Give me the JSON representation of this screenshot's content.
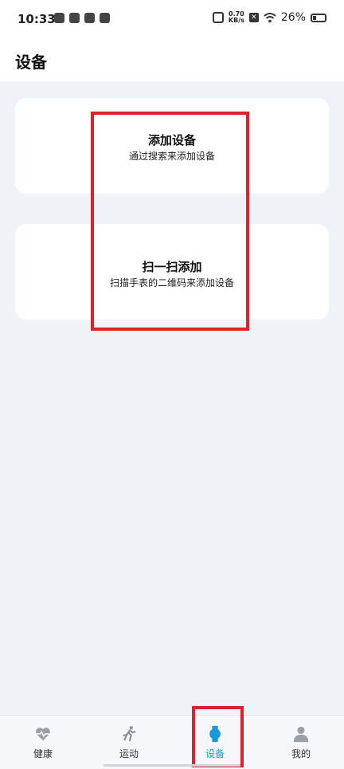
{
  "status_bar": {
    "time": "10:33",
    "net_speed_value": "0.70",
    "net_speed_unit": "KB/s",
    "battery": "26%"
  },
  "header": {
    "title": "设备"
  },
  "cards": [
    {
      "title": "添加设备",
      "subtitle": "通过搜索来添加设备"
    },
    {
      "title": "扫一扫添加",
      "subtitle": "扫描手表的二维码来添加设备"
    }
  ],
  "tabs": [
    {
      "label": "健康",
      "icon": "heart-pulse-icon"
    },
    {
      "label": "运动",
      "icon": "running-icon"
    },
    {
      "label": "设备",
      "icon": "watch-icon",
      "active": true
    },
    {
      "label": "我的",
      "icon": "person-icon"
    }
  ],
  "colors": {
    "accent": "#1a9bd8",
    "highlight": "#e0212c",
    "background": "#eff2f7"
  }
}
